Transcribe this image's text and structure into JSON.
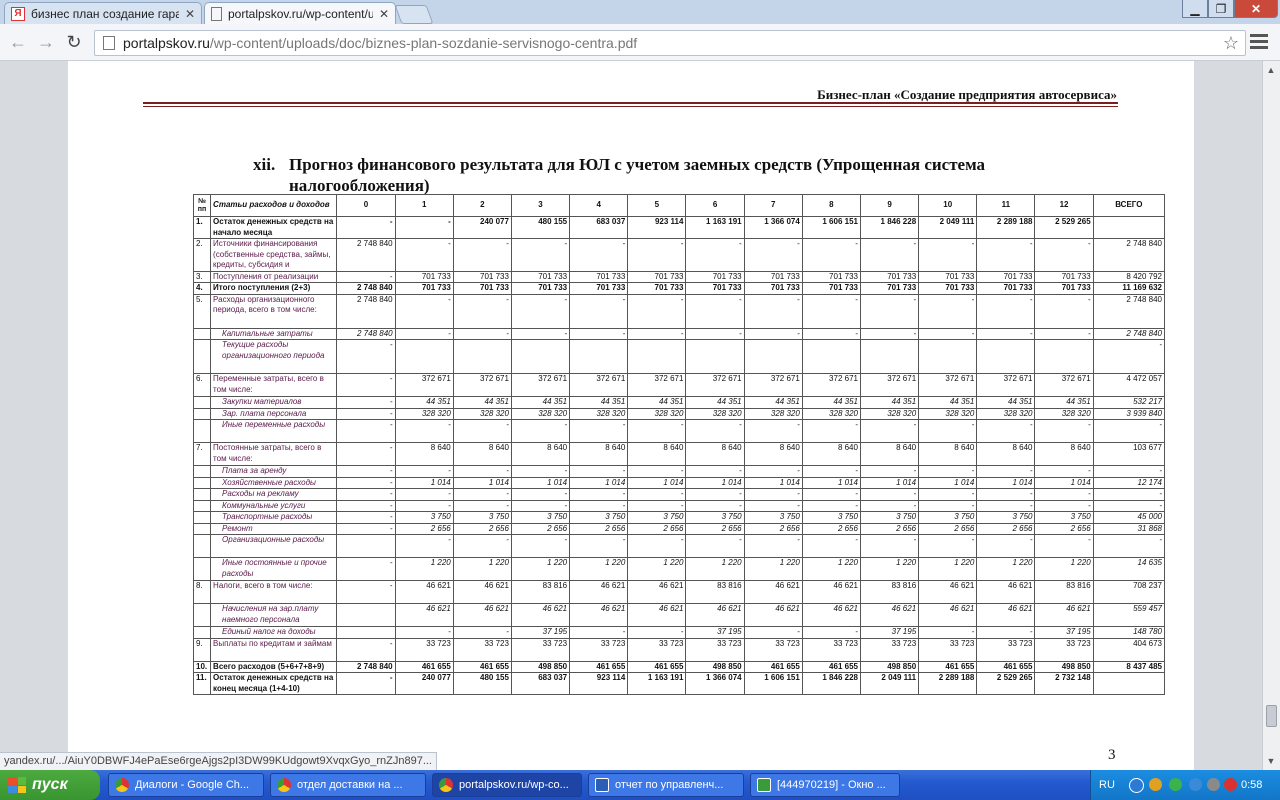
{
  "browser": {
    "tabs": [
      {
        "title": "бизнес план создание гара",
        "icon": "yandex-icon",
        "active": false
      },
      {
        "title": "portalpskov.ru/wp-content/u",
        "icon": "page-icon",
        "active": true
      }
    ],
    "url_host": "portalpskov.ru",
    "url_path": "/wp-content/uploads/doc/biznes-plan-sozdanie-servisnogo-centra.pdf",
    "status_url": "yandex.ru/.../AiuY0DBWFJ4ePaEse6rgeAjgs2pI3DW99KUdgowt9XvqxGyo_rnZJn897..."
  },
  "document": {
    "header": "Бизнес-план «Создание предприятия автосервиса»",
    "section_number": "xii.",
    "section_title_line1": "Прогноз финансового результата для ЮЛ с учетом заемных средств (Упрощенная система",
    "section_title_line2": "налогообложения)",
    "page_number": "3",
    "table": {
      "headers": [
        "№ пп",
        "Статьи расходов и доходов",
        "0",
        "1",
        "2",
        "3",
        "4",
        "5",
        "6",
        "7",
        "8",
        "9",
        "10",
        "11",
        "12",
        "ВСЕГО"
      ],
      "rows": [
        {
          "no": "1.",
          "label": "Остаток денежных средств на начало месяца",
          "bold": true,
          "h": 21,
          "v": [
            "-",
            "-",
            "240 077",
            "480 155",
            "683 037",
            "923 114",
            "1 163 191",
            "1 366 074",
            "1 606 151",
            "1 846 228",
            "2 049 111",
            "2 289 188",
            "2 529 265",
            ""
          ]
        },
        {
          "no": "2.",
          "label": "Источники финансирования (собственные средства, займы, кредиты, субсидия и",
          "h": 32,
          "v": [
            "2 748 840",
            "-",
            "-",
            "-",
            "-",
            "-",
            "-",
            "-",
            "-",
            "-",
            "-",
            "-",
            "-",
            "2 748 840"
          ]
        },
        {
          "no": "3.",
          "label": "Поступления от реализации",
          "h": 11,
          "v": [
            "-",
            "701 733",
            "701 733",
            "701 733",
            "701 733",
            "701 733",
            "701 733",
            "701 733",
            "701 733",
            "701 733",
            "701 733",
            "701 733",
            "701 733",
            "8 420 792"
          ]
        },
        {
          "no": "4.",
          "label": "Итого поступления (2+3)",
          "bold": true,
          "h": 11,
          "v": [
            "2 748 840",
            "701 733",
            "701 733",
            "701 733",
            "701 733",
            "701 733",
            "701 733",
            "701 733",
            "701 733",
            "701 733",
            "701 733",
            "701 733",
            "701 733",
            "11 169 632"
          ]
        },
        {
          "no": "5.",
          "label": "Расходы организационного периода, всего в том числе:",
          "h": 34,
          "v": [
            "2 748 840",
            "-",
            "-",
            "-",
            "-",
            "-",
            "-",
            "-",
            "-",
            "-",
            "-",
            "-",
            "-",
            "2 748 840"
          ]
        },
        {
          "no": "",
          "label": "Капитальные затраты",
          "italic": true,
          "h": 11,
          "v": [
            "2 748 840",
            "-",
            "-",
            "-",
            "-",
            "-",
            "-",
            "-",
            "-",
            "-",
            "-",
            "-",
            "-",
            "2 748 840"
          ]
        },
        {
          "no": "",
          "label": "Текущие расходы организационного периода",
          "italic": true,
          "h": 34,
          "v": [
            "-",
            "",
            "",
            "",
            "",
            "",
            "",
            "",
            "",
            "",
            "",
            "",
            "",
            "-"
          ]
        },
        {
          "no": "6.",
          "label": "Переменные затраты, всего в том числе:",
          "h": 23,
          "v": [
            "-",
            "372 671",
            "372 671",
            "372 671",
            "372 671",
            "372 671",
            "372 671",
            "372 671",
            "372 671",
            "372 671",
            "372 671",
            "372 671",
            "372 671",
            "4 472 057"
          ]
        },
        {
          "no": "",
          "label": "Закупки материалов",
          "italic": true,
          "h": 11,
          "v": [
            "-",
            "44 351",
            "44 351",
            "44 351",
            "44 351",
            "44 351",
            "44 351",
            "44 351",
            "44 351",
            "44 351",
            "44 351",
            "44 351",
            "44 351",
            "532 217"
          ]
        },
        {
          "no": "",
          "label": "Зар. плата персонала",
          "italic": true,
          "h": 11,
          "v": [
            "-",
            "328 320",
            "328 320",
            "328 320",
            "328 320",
            "328 320",
            "328 320",
            "328 320",
            "328 320",
            "328 320",
            "328 320",
            "328 320",
            "328 320",
            "3 939 840"
          ]
        },
        {
          "no": "",
          "label": "Иные переменные расходы",
          "italic": true,
          "h": 23,
          "v": [
            "-",
            "-",
            "-",
            "-",
            "-",
            "-",
            "-",
            "-",
            "-",
            "-",
            "-",
            "-",
            "-",
            "-"
          ]
        },
        {
          "no": "7.",
          "label": "Постоянные затраты, всего в том числе:",
          "h": 23,
          "v": [
            "-",
            "8 640",
            "8 640",
            "8 640",
            "8 640",
            "8 640",
            "8 640",
            "8 640",
            "8 640",
            "8 640",
            "8 640",
            "8 640",
            "8 640",
            "103 677"
          ]
        },
        {
          "no": "",
          "label": "Плата за аренду",
          "italic": true,
          "h": 11,
          "v": [
            "-",
            "-",
            "-",
            "-",
            "-",
            "-",
            "-",
            "-",
            "-",
            "-",
            "-",
            "-",
            "-",
            "-"
          ]
        },
        {
          "no": "",
          "label": "Хозяйственные расходы",
          "italic": true,
          "h": 11,
          "v": [
            "-",
            "1 014",
            "1 014",
            "1 014",
            "1 014",
            "1 014",
            "1 014",
            "1 014",
            "1 014",
            "1 014",
            "1 014",
            "1 014",
            "1 014",
            "12 174"
          ]
        },
        {
          "no": "",
          "label": "Расходы на рекламу",
          "italic": true,
          "h": 11,
          "v": [
            "-",
            "-",
            "-",
            "-",
            "-",
            "-",
            "-",
            "-",
            "-",
            "-",
            "-",
            "-",
            "-",
            "-"
          ]
        },
        {
          "no": "",
          "label": "Коммунальные услуги",
          "italic": true,
          "h": 11,
          "v": [
            "-",
            "-",
            "-",
            "-",
            "-",
            "-",
            "-",
            "-",
            "-",
            "-",
            "-",
            "-",
            "-",
            "-"
          ]
        },
        {
          "no": "",
          "label": "Транспортные расходы",
          "italic": true,
          "h": 11,
          "v": [
            "-",
            "3 750",
            "3 750",
            "3 750",
            "3 750",
            "3 750",
            "3 750",
            "3 750",
            "3 750",
            "3 750",
            "3 750",
            "3 750",
            "3 750",
            "45 000"
          ]
        },
        {
          "no": "",
          "label": "Ремонт",
          "italic": true,
          "h": 11,
          "v": [
            "-",
            "2 656",
            "2 656",
            "2 656",
            "2 656",
            "2 656",
            "2 656",
            "2 656",
            "2 656",
            "2 656",
            "2 656",
            "2 656",
            "2 656",
            "31 868"
          ]
        },
        {
          "no": "",
          "label": "Организационные расходы",
          "italic": true,
          "h": 23,
          "v": [
            "",
            "-",
            "-",
            "-",
            "-",
            "-",
            "-",
            "-",
            "-",
            "-",
            "-",
            "-",
            "-",
            "-"
          ]
        },
        {
          "no": "",
          "label": "Иные постоянные и прочие расходы",
          "italic": true,
          "h": 23,
          "v": [
            "-",
            "1 220",
            "1 220",
            "1 220",
            "1 220",
            "1 220",
            "1 220",
            "1 220",
            "1 220",
            "1 220",
            "1 220",
            "1 220",
            "1 220",
            "14 635"
          ]
        },
        {
          "no": "8.",
          "label": "Налоги, всего в том числе:",
          "h": 23,
          "v": [
            "-",
            "46 621",
            "46 621",
            "83 816",
            "46 621",
            "46 621",
            "83 816",
            "46 621",
            "46 621",
            "83 816",
            "46 621",
            "46 621",
            "83 816",
            "708 237"
          ]
        },
        {
          "no": "",
          "label": "Начисления на зар.плату наемного персонала",
          "italic": true,
          "h": 23,
          "v": [
            "",
            "46 621",
            "46 621",
            "46 621",
            "46 621",
            "46 621",
            "46 621",
            "46 621",
            "46 621",
            "46 621",
            "46 621",
            "46 621",
            "46 621",
            "559 457"
          ]
        },
        {
          "no": "",
          "label": "Единый налог на доходы",
          "italic": true,
          "h": 11,
          "v": [
            "",
            "-",
            "-",
            "37 195",
            "-",
            "-",
            "37 195",
            "-",
            "-",
            "37 195",
            "-",
            "-",
            "37 195",
            "148 780"
          ]
        },
        {
          "no": "9.",
          "label": "Выплаты по кредитам и займам",
          "h": 23,
          "v": [
            "-",
            "33 723",
            "33 723",
            "33 723",
            "33 723",
            "33 723",
            "33 723",
            "33 723",
            "33 723",
            "33 723",
            "33 723",
            "33 723",
            "33 723",
            "404 673"
          ]
        },
        {
          "no": "10.",
          "label": "Всего расходов (5+6+7+8+9)",
          "bold": true,
          "h": 11,
          "v": [
            "2 748 840",
            "461 655",
            "461 655",
            "498 850",
            "461 655",
            "461 655",
            "498 850",
            "461 655",
            "461 655",
            "498 850",
            "461 655",
            "461 655",
            "498 850",
            "8 437 485"
          ]
        },
        {
          "no": "11.",
          "label": "Остаток денежных средств на конец месяца (1+4-10)",
          "bold": true,
          "h": 22,
          "v": [
            "-",
            "240 077",
            "480 155",
            "683 037",
            "923 114",
            "1 163 191",
            "1 366 074",
            "1 606 151",
            "1 846 228",
            "2 049 111",
            "2 289 188",
            "2 529 265",
            "2 732 148",
            ""
          ]
        }
      ]
    }
  },
  "taskbar": {
    "start_label": "пуск",
    "tasks": [
      {
        "label": "Диалоги - Google Ch...",
        "icon": "chrome",
        "active": false
      },
      {
        "label": "отдел доставки на ...",
        "icon": "chrome",
        "active": false
      },
      {
        "label": "portalpskov.ru/wp-co...",
        "icon": "chrome",
        "active": true
      },
      {
        "label": "отчет по управленч...",
        "icon": "word",
        "active": false
      },
      {
        "label": "[444970219] - Окно ...",
        "icon": "sheet",
        "active": false
      }
    ],
    "lang": "RU",
    "clock": "0:58"
  }
}
